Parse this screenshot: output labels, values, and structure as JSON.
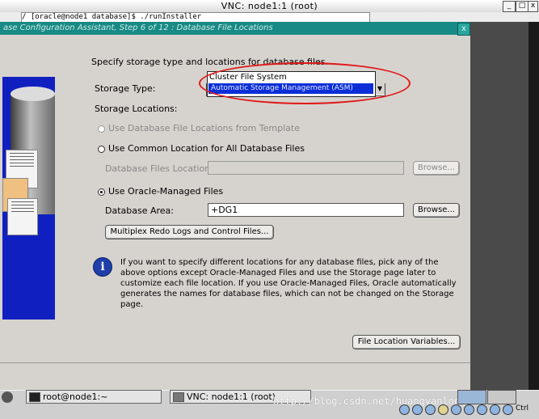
{
  "vnc_window": {
    "title": "VNC: node1:1 (root)",
    "btn_min": "_",
    "btn_max": "□",
    "btn_close": "x"
  },
  "remote_strip_text": "/ [oracle@node1 database]$ ./runInstaller",
  "installer": {
    "title": "ase Configuration Assistant, Step 6 of 12 : Database File Locations",
    "btn_close": "x"
  },
  "form": {
    "intro": "Specify storage type and locations for database files.",
    "storage_type_label": "Storage Type:",
    "storage_type_options": [
      "Cluster File System",
      "Automatic Storage Management (ASM)"
    ],
    "storage_type_selected": "Automatic Storage Management (ASM)",
    "storage_locations_label": "Storage Locations:",
    "radio_template": "Use Database File Locations from Template",
    "radio_common": "Use Common Location for All Database Files",
    "db_files_location_label": "Database Files Location:",
    "db_files_location_value": "",
    "browse_label": "Browse...",
    "radio_omf": "Use Oracle-Managed Files",
    "db_area_label": "Database Area:",
    "db_area_value": "+DG1",
    "multiplex_button": "Multiplex Redo Logs and Control Files...",
    "info_text": "If you want to specify different locations for any database files, pick any of the above options except Oracle-Managed Files and use the Storage page later to customize each file location. If you use Oracle-Managed Files, Oracle automatically generates the names for database files, which can not be changed on the Storage page.",
    "file_location_variables_button": "File Location Variables..."
  },
  "taskbar": {
    "task1": "root@node1:~",
    "task2": "VNC: node1:1 (root)",
    "watermark": "http://blog.csdn.net/huangyanlong",
    "clock_label": "Ctrl"
  },
  "colors": {
    "installer_title": "#178a85",
    "highlight": "#0a2fd8",
    "annotation": "#e01818",
    "left_panel": "#1020c0"
  }
}
